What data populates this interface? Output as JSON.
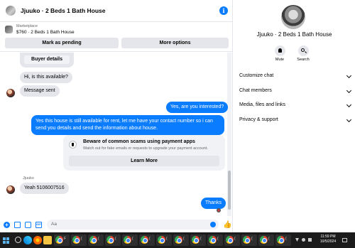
{
  "header": {
    "title": "Jjuuko · 2 Beds 1 Bath House",
    "info_icon": "i"
  },
  "marketplace": {
    "label": "Marketplace",
    "item": "$760 · 2 Beds 1 Bath House",
    "mark_pending": "Mark as pending",
    "more_options": "More options"
  },
  "messages": {
    "buyer_details": "Buyer details",
    "m1": "Hi, is this available?",
    "m2": "Message sent",
    "m3": "Yes, are you interested?",
    "m4_line1": "Yes this house is still available for rent, let me have your contact number so i can",
    "m4_line2": "send you details and send the information about house.",
    "warning_title": "Beware of common scams using payment apps",
    "warning_sub": "Watch out for fake emails or requests to upgrade your payment account.",
    "learn_more": "Learn More",
    "sender": "Jjuuko",
    "m5": "Yeah 5106007516",
    "m6": "Thanks"
  },
  "composer": {
    "placeholder": "Aa"
  },
  "info": {
    "name": "Jjuuko · 2 Beds 1 Bath House",
    "mute": "Mute",
    "search": "Search",
    "sections": [
      "Customize chat",
      "Chat members",
      "Media, files and links",
      "Privacy & support"
    ]
  },
  "taskbar": {
    "time": "11:59 PM",
    "date": "10/5/2024"
  },
  "colors": {
    "accent": "#0a7cff",
    "bubble_in": "#e4e6eb",
    "taskbar": "#1c1c1c"
  }
}
